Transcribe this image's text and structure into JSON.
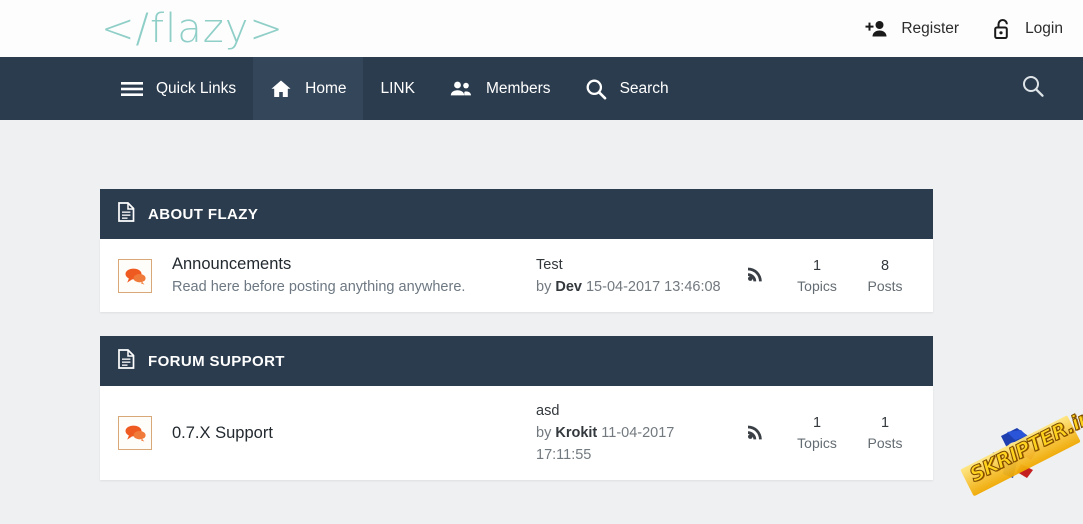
{
  "header": {
    "logo": "</flazy>",
    "logo_color": "#8fcfc8",
    "links": [
      {
        "label": "Register",
        "icon": "person-add-icon"
      },
      {
        "label": "Login",
        "icon": "unlock-icon"
      }
    ]
  },
  "navbar": {
    "background": "#2b3c4e",
    "items": [
      {
        "label": "Quick Links",
        "icon": "hamburger-icon",
        "active": false
      },
      {
        "label": "Home",
        "icon": "home-icon",
        "active": true
      },
      {
        "label": "LINK",
        "icon": "none",
        "active": false
      },
      {
        "label": "Members",
        "icon": "people-icon",
        "active": false
      },
      {
        "label": "Search",
        "icon": "search-icon",
        "active": false
      }
    ],
    "right_icon": "search-icon"
  },
  "categories": [
    {
      "title": "ABOUT FLAZY",
      "icon": "document-icon",
      "forums": [
        {
          "name": "Announcements",
          "description": "Read here before posting anything anywhere.",
          "icon": "forum-bubbles-icon",
          "lastpost_title": "Test",
          "lastpost_by_prefix": "by ",
          "lastpost_author": "Dev",
          "lastpost_date": " 15-04-2017 13:46:08",
          "rss_icon": "rss-icon",
          "topics_count": "1",
          "topics_label": "Topics",
          "posts_count": "8",
          "posts_label": "Posts"
        }
      ]
    },
    {
      "title": "FORUM SUPPORT",
      "icon": "document-icon",
      "forums": [
        {
          "name": "0.7.X Support",
          "description": "",
          "icon": "forum-bubbles-icon",
          "lastpost_title": "asd",
          "lastpost_by_prefix": "by ",
          "lastpost_author": "Krokit",
          "lastpost_date": " 11-04-2017 17:11:55",
          "rss_icon": "rss-icon",
          "topics_count": "1",
          "topics_label": "Topics",
          "posts_count": "1",
          "posts_label": "Posts"
        }
      ]
    }
  ],
  "watermark": {
    "text": "SKRIPTER.info",
    "color": "#ffd21e"
  }
}
